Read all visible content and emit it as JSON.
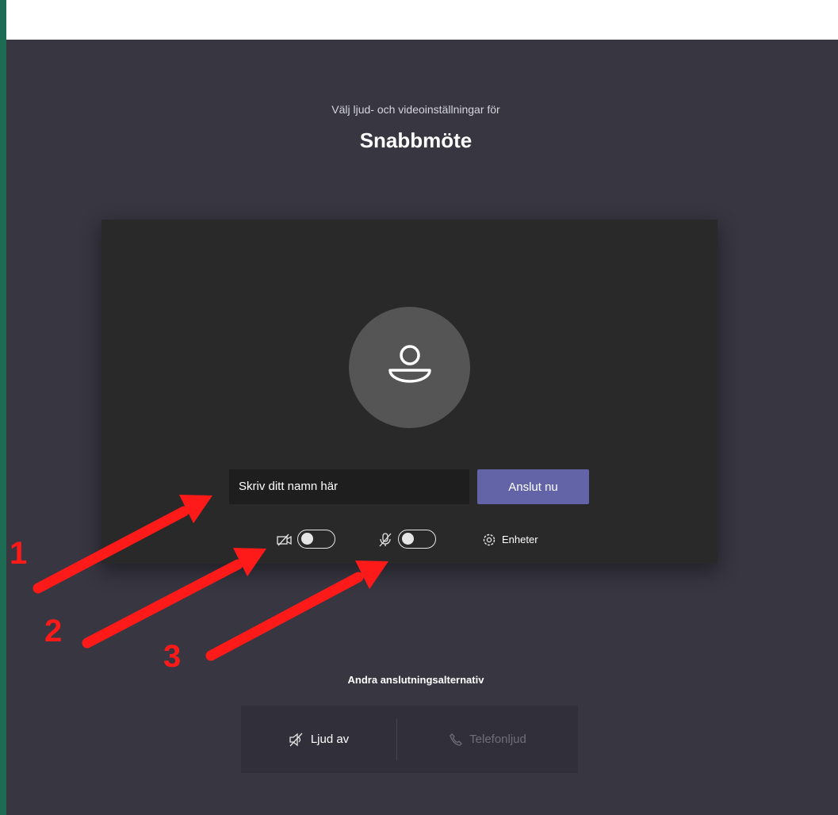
{
  "prejoin": {
    "subtitle": "Välj ljud- och videoinställningar för",
    "meeting_title": "Snabbmöte"
  },
  "preview": {
    "name_placeholder": "Skriv ditt namn här",
    "join_label": "Anslut nu",
    "devices_label": "Enheter",
    "camera_toggle": "off",
    "mic_toggle": "off"
  },
  "other": {
    "title": "Andra anslutningsalternativ",
    "audio_off_label": "Ljud av",
    "phone_audio_label": "Telefonljud"
  },
  "annotations": {
    "labels": [
      "1",
      "2",
      "3"
    ],
    "color": "#ff1a1a"
  },
  "colors": {
    "background": "#373641",
    "accent": "#6264a7",
    "preview_bg": "#292929"
  },
  "icons": {
    "avatar": "person-icon",
    "camera": "camera-off-icon",
    "mic": "mic-off-icon",
    "devices": "gear-icon",
    "audio_off": "speaker-off-icon",
    "phone": "phone-icon"
  }
}
